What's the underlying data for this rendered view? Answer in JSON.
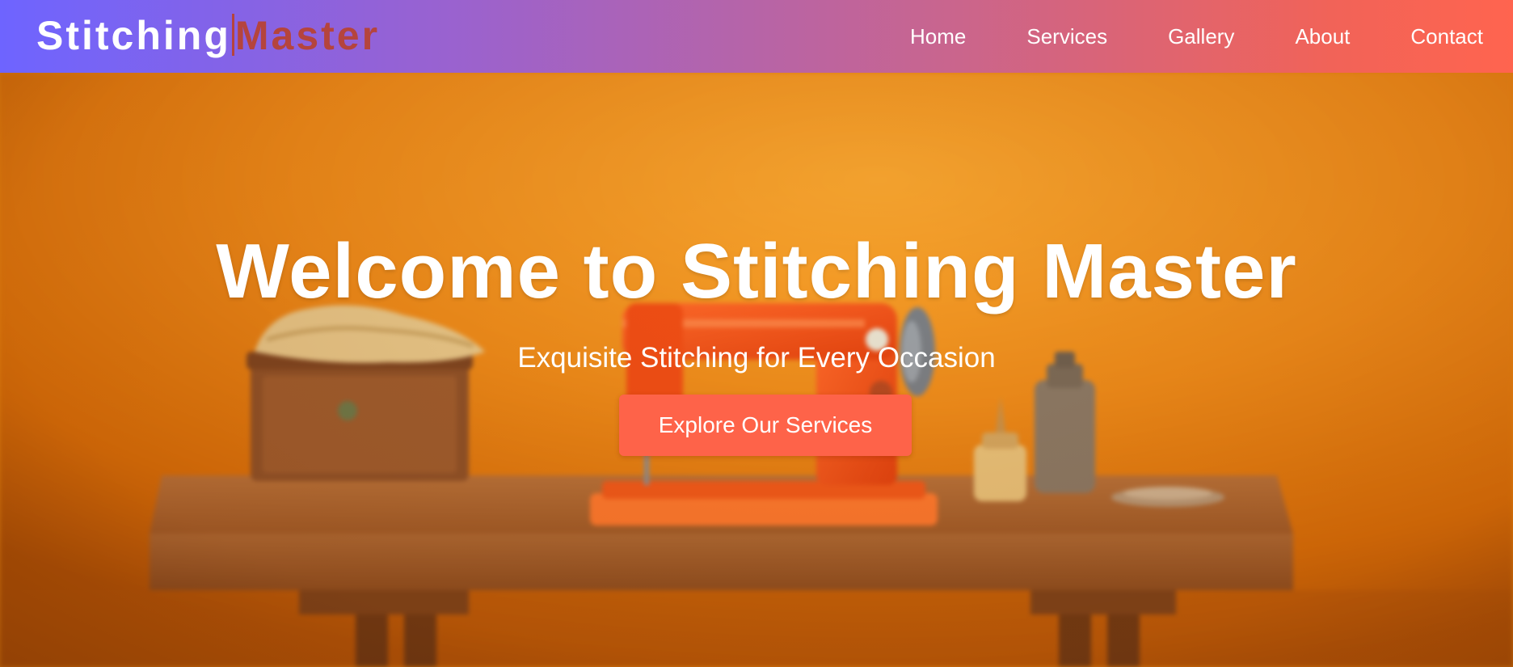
{
  "brand": {
    "part1": "Stitching",
    "part2": "Master"
  },
  "nav": {
    "items": [
      {
        "label": "Home"
      },
      {
        "label": "Services"
      },
      {
        "label": "Gallery"
      },
      {
        "label": "About"
      },
      {
        "label": "Contact"
      }
    ]
  },
  "hero": {
    "title": "Welcome to Stitching Master",
    "subtitle": "Exquisite Stitching for Every Occasion",
    "button_label": "Explore Our Services",
    "image_alt": "Orange sewing machine on a wooden table"
  },
  "colors": {
    "nav_gradient_start": "#6e64ff",
    "nav_gradient_end": "#ff644f",
    "brand_accent": "#b5443d",
    "button": "#fe6349",
    "hero_background": "#e8850f"
  }
}
